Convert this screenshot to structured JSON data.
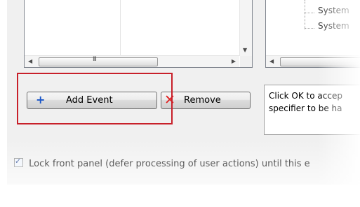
{
  "left_list": {
    "scroll_grip": "III"
  },
  "tree": {
    "items": [
      "System",
      "System"
    ]
  },
  "buttons": {
    "add_event": "Add Event",
    "remove": "Remove"
  },
  "info": {
    "line1": "Click OK to accep",
    "line2": "specifier to be ha"
  },
  "lock_panel": {
    "checked": true,
    "label": "Lock front panel (defer processing of user actions) until this e"
  },
  "colors": {
    "highlight": "#c8202a",
    "add_icon": "#1a56c8",
    "remove_icon": "#e02020"
  },
  "icons": {
    "add": "plus-icon",
    "remove": "x-icon"
  }
}
